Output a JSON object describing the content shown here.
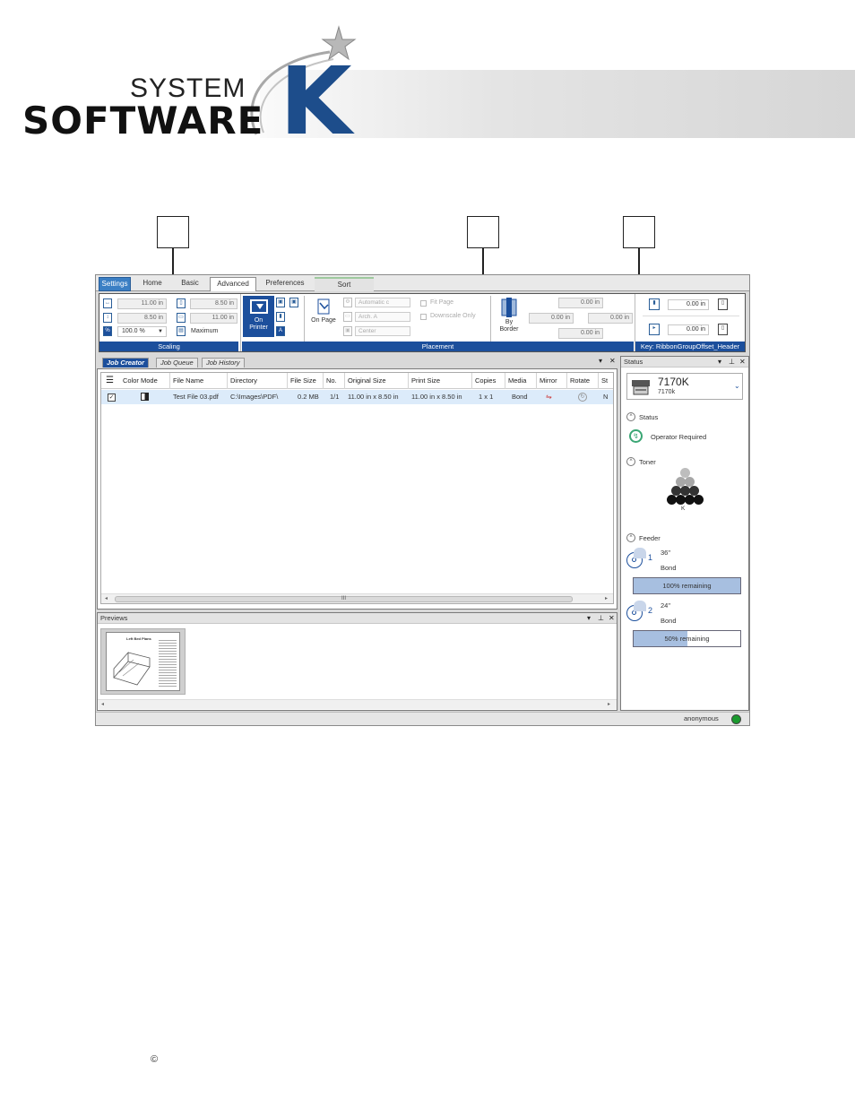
{
  "brand": {
    "line1": "SYSTEM",
    "line2": "SOFTWARE",
    "letter": "K"
  },
  "ribbon_tabs": [
    "Settings",
    "Home",
    "Basic",
    "Advanced",
    "Preferences",
    "Sort"
  ],
  "scaling": {
    "width": "11.00 in",
    "height": "8.50 in",
    "percent": "100.0 %",
    "max_width": "8.50 in",
    "max_height": "11.00 in",
    "maximum_label": "Maximum",
    "group_label": "Scaling"
  },
  "placement": {
    "on_printer": "On Printer",
    "on_page": "On Page",
    "dd1": "Automatic c",
    "dd2": "Arch. A",
    "dd3": "Center",
    "fit_page": "Fit Page",
    "downscale_only": "Downscale Only",
    "by_border": "By Border",
    "v1": "0.00 in",
    "v2": "0.00 in",
    "v3": "0.00 in",
    "v4": "0.00 in",
    "group_label": "Placement"
  },
  "offset": {
    "v1": "0.00 in",
    "v2": "0.00 in",
    "group_label": "Key: RibbonGroupOffset_Header"
  },
  "job_tabs": [
    "Job Creator",
    "Job Queue",
    "Job History"
  ],
  "table": {
    "headers": [
      "Color Mode",
      "File Name",
      "Directory",
      "File Size",
      "No.",
      "Original Size",
      "Print Size",
      "Copies",
      "Media",
      "Mirror",
      "Rotate",
      "St"
    ],
    "row": [
      "Test File 03.pdf",
      "C:\\Images\\PDF\\",
      "0.2 MB",
      "1/1",
      "11.00 in x 8.50 in",
      "11.00 in x 8.50 in",
      "1 x 1",
      "Bond",
      "N"
    ]
  },
  "scroll_thumb": "III",
  "previews": {
    "title": "Previews",
    "thumb_title": "Left Bed Plans"
  },
  "status_panel": {
    "title": "Status",
    "printer_model": "7170K",
    "printer_sub": "7170k",
    "status_heading": "Status",
    "status_text": "Operator Required",
    "toner_heading": "Toner",
    "toner_label": "K",
    "feeder_heading": "Feeder",
    "feeders": [
      {
        "num": "1",
        "size": "36\"",
        "media": "Bond",
        "remaining": "100% remaining",
        "fraction": 1.0
      },
      {
        "num": "2",
        "size": "24\"",
        "media": "Bond",
        "remaining": "50% remaining",
        "fraction": 0.5
      }
    ]
  },
  "footer": {
    "user": "anonymous",
    "status_color": "#1a9a2e"
  },
  "colors": {
    "accent": "#1c4f9c",
    "brand_k": "#1d4d8b"
  },
  "copyright": "©"
}
